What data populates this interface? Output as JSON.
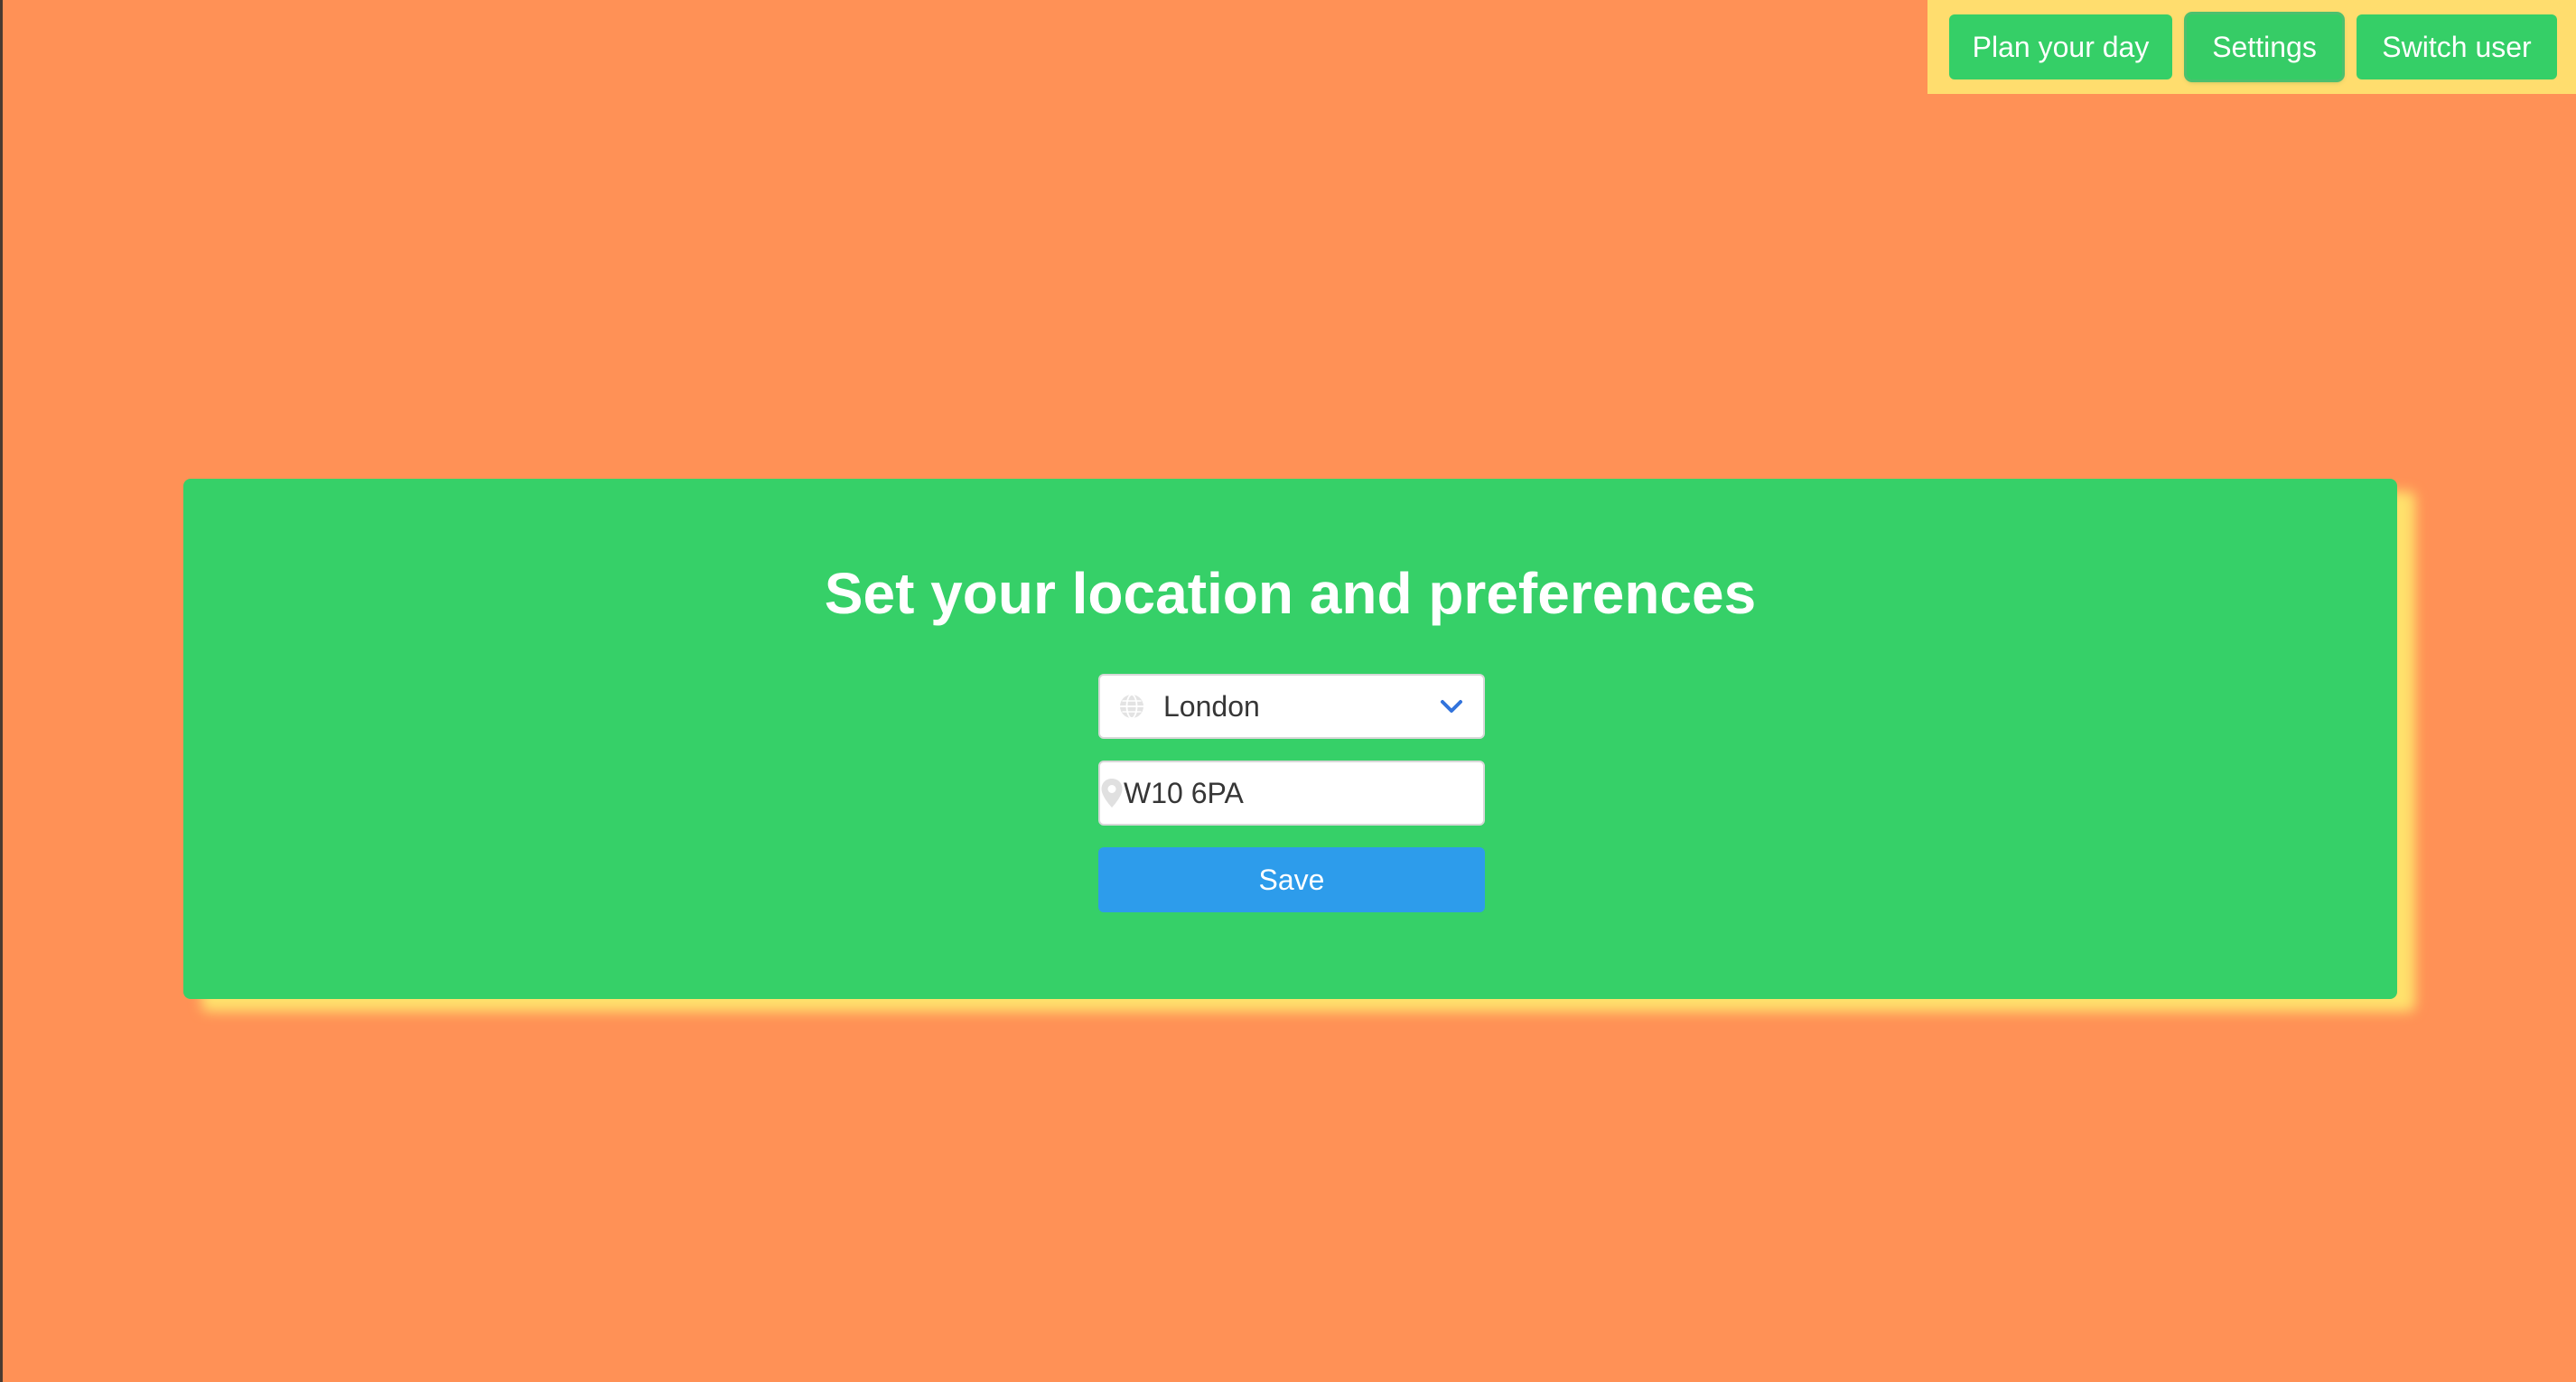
{
  "nav": {
    "plan_label": "Plan your day",
    "settings_label": "Settings",
    "switch_user_label": "Switch user",
    "active": "Settings"
  },
  "card": {
    "title": "Set your location and preferences",
    "city_select": {
      "icon": "globe-icon",
      "selected": "London",
      "chevron_icon": "chevron-down-icon"
    },
    "postcode_input": {
      "icon": "map-marker-icon",
      "value": "W10 6PA"
    },
    "save_label": "Save"
  },
  "colors": {
    "page_background": "#FF9156",
    "nav_background": "#FFDD6E",
    "nav_button": "#35CF67",
    "card_background": "#36D068",
    "card_shadow": "#FFE66E",
    "save_button": "#2D9CEB",
    "chevron": "#3273DC"
  }
}
